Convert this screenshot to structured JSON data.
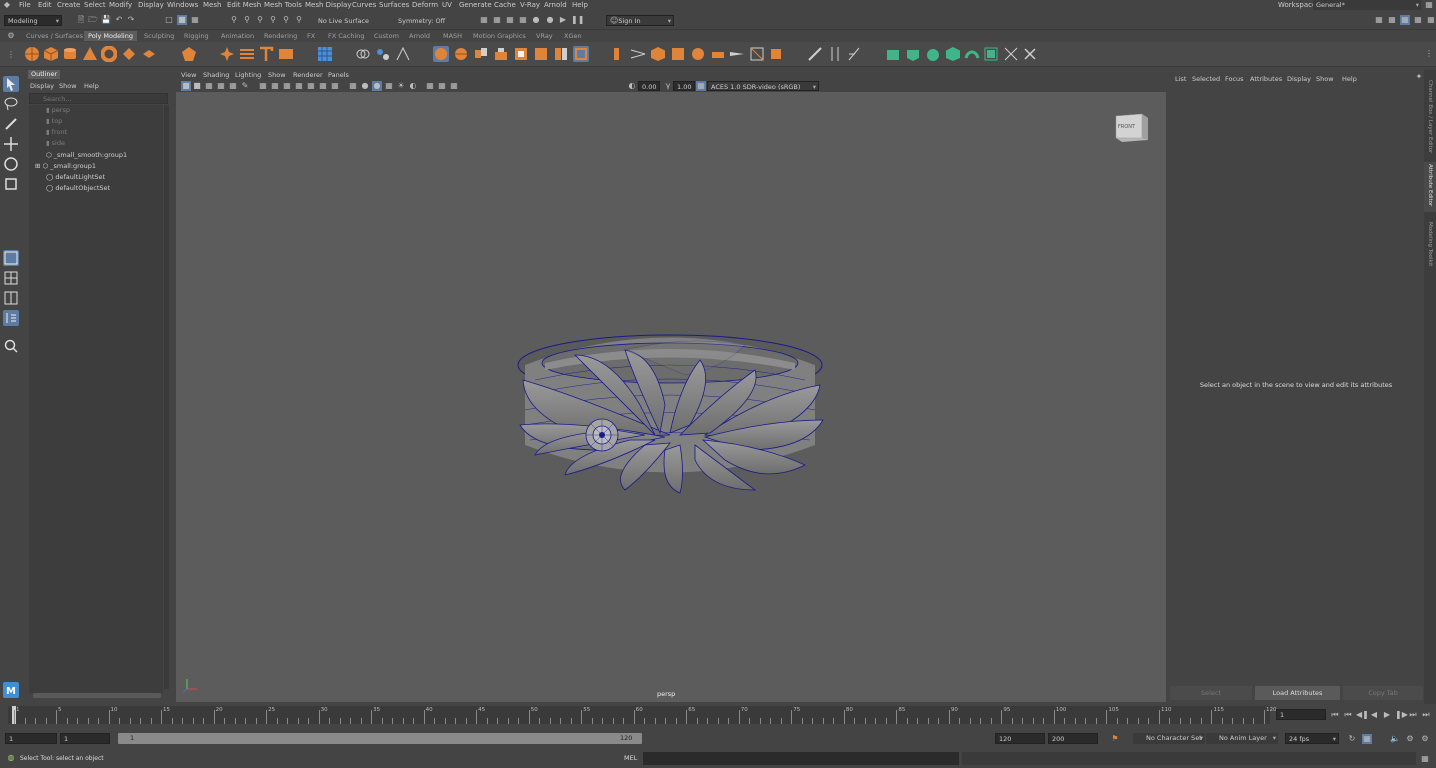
{
  "menubar": {
    "items": [
      "File",
      "Edit",
      "Create",
      "Select",
      "Modify",
      "Display",
      "Windows",
      "Mesh",
      "Edit Mesh",
      "Mesh Tools",
      "Mesh Display",
      "Curves",
      "Surfaces",
      "Deform",
      "UV",
      "Generate",
      "Cache",
      "V-Ray",
      "Arnold",
      "Help"
    ],
    "workspace_label": "Workspace:",
    "workspace_value": "General*"
  },
  "statusline": {
    "mode": "Modeling",
    "live_surface": "No Live Surface",
    "symmetry": "Symmetry: Off",
    "sign_in": "Sign In"
  },
  "shelf": {
    "tabs": [
      "Curves / Surfaces",
      "Poly Modeling",
      "Sculpting",
      "Rigging",
      "Animation",
      "Rendering",
      "FX",
      "FX Caching",
      "Custom",
      "Arnold",
      "MASH",
      "Motion Graphics",
      "VRay",
      "XGen"
    ],
    "active_tab": "Poly Modeling"
  },
  "outliner": {
    "title": "Outliner",
    "menu": [
      "Display",
      "Show",
      "Help"
    ],
    "search_placeholder": "Search...",
    "items": [
      "persp",
      "top",
      "front",
      "side",
      "_small_smooth:group1",
      "_small:group1",
      "defaultLightSet",
      "defaultObjectSet"
    ]
  },
  "viewport": {
    "menu": [
      "View",
      "Shading",
      "Lighting",
      "Show",
      "Renderer",
      "Panels"
    ],
    "exposure": "0.00",
    "gamma": "1.00",
    "color_space": "ACES 1.0 SDR-video (sRGB)",
    "camera_label": "persp",
    "viewcube_label": "FRONT"
  },
  "attribute_editor": {
    "menu": [
      "List",
      "Selected",
      "Focus",
      "Attributes",
      "Display",
      "Show",
      "Help"
    ],
    "message": "Select an object in the scene to view and edit its attributes",
    "buttons": [
      "Select",
      "Load Attributes",
      "Copy Tab"
    ],
    "side_tabs": [
      "Channel Box / Layer Editor",
      "Attribute Editor",
      "Modeling Toolkit"
    ]
  },
  "timeline": {
    "ticks": [
      "1",
      "5",
      "10",
      "15",
      "20",
      "25",
      "30",
      "35",
      "40",
      "45",
      "50",
      "55",
      "60",
      "65",
      "70",
      "75",
      "80",
      "85",
      "90",
      "95",
      "100",
      "105",
      "110",
      "115",
      "120"
    ],
    "current_frame": "1"
  },
  "range": {
    "start": "1",
    "playback_start": "1",
    "slider_start": "1",
    "slider_end": "120",
    "playback_end": "120",
    "end": "200",
    "character_set": "No Character Set",
    "anim_layer": "No Anim Layer",
    "fps": "24 fps"
  },
  "command": {
    "help_text": "Select Tool: select an object",
    "lang": "MEL"
  },
  "colors": {
    "background": "#444444",
    "viewport": "#5c5c5c",
    "active_tab": "#5d5d5d",
    "wire": "#1a1a8c",
    "shelf_orange": "#e0843a",
    "shelf_green": "#3fb58a",
    "accent_blue": "#4d8fd6"
  }
}
